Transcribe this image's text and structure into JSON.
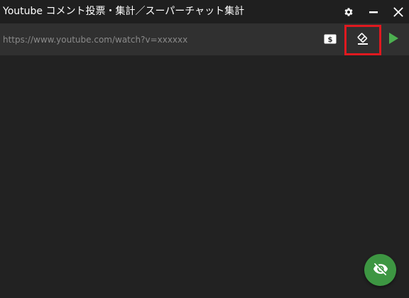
{
  "window": {
    "title": "Youtube コメント投票・集計／スーパーチャット集計"
  },
  "titlebar_buttons": [
    {
      "name": "settings",
      "icon": "gear-icon"
    },
    {
      "name": "minimize",
      "icon": "minimize-icon"
    },
    {
      "name": "close",
      "icon": "close-icon"
    }
  ],
  "url_bar": {
    "value": "",
    "placeholder": "https://www.youtube.com/watch?v=xxxxxx",
    "buttons": [
      {
        "name": "superchat",
        "icon": "dollar-bill-icon"
      },
      {
        "name": "clear",
        "icon": "eraser-icon",
        "highlighted": true,
        "highlight_color": "#e0191f"
      },
      {
        "name": "start",
        "icon": "play-icon",
        "color": "#4caf50"
      }
    ]
  },
  "fab": {
    "icon": "eye-off-icon",
    "color": "#3d9642"
  },
  "colors": {
    "background": "#222222",
    "titlebar": "#1f1f1f",
    "url_bar": "#303030",
    "accent_green": "#4caf50"
  }
}
